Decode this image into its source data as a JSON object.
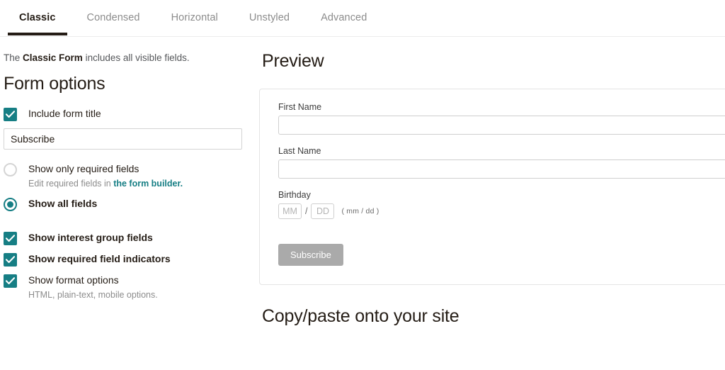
{
  "tabs": [
    {
      "label": "Classic",
      "active": true
    },
    {
      "label": "Condensed",
      "active": false
    },
    {
      "label": "Horizontal",
      "active": false
    },
    {
      "label": "Unstyled",
      "active": false
    },
    {
      "label": "Advanced",
      "active": false
    }
  ],
  "left": {
    "intro_prefix": "The ",
    "intro_bold": "Classic Form",
    "intro_suffix": " includes all visible fields.",
    "section_title": "Form options",
    "include_form_title": {
      "label": "Include form title",
      "checked": true
    },
    "form_title_value": "Subscribe",
    "show_only_required": {
      "label": "Show only required fields",
      "sub_prefix": "Edit required fields in ",
      "sub_link": "the form builder.",
      "selected": false
    },
    "show_all_fields": {
      "label": "Show all fields",
      "selected": true
    },
    "checkboxes": [
      {
        "label": "Show interest group fields",
        "checked": true,
        "bold": true,
        "sub": ""
      },
      {
        "label": "Show required field indicators",
        "checked": true,
        "bold": true,
        "sub": ""
      },
      {
        "label": "Show format options",
        "checked": true,
        "bold": false,
        "sub": "HTML, plain-text, mobile options."
      }
    ]
  },
  "right": {
    "preview_title": "Preview",
    "fields": [
      {
        "label": "First Name",
        "value": ""
      },
      {
        "label": "Last Name",
        "value": ""
      }
    ],
    "birthday": {
      "label": "Birthday",
      "month_placeholder": "MM",
      "separator": "/",
      "day_placeholder": "DD",
      "hint": "( mm / dd )"
    },
    "submit_label": "Subscribe",
    "copy_title": "Copy/paste onto your site"
  },
  "colors": {
    "accent_teal": "#167e84",
    "active_tab_underline": "#241c15",
    "submit_gray": "#aaaaaa",
    "muted_text": "#8c8c8c"
  }
}
